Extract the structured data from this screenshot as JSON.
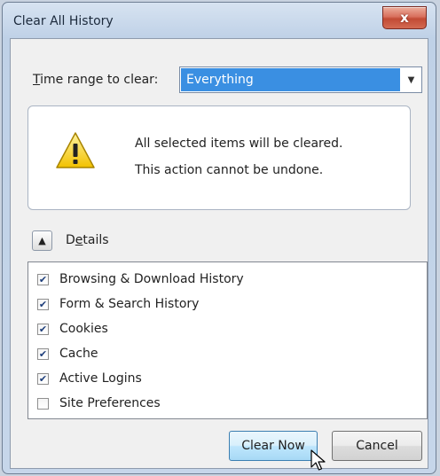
{
  "window": {
    "title": "Clear All History",
    "close_label": "x"
  },
  "time_range": {
    "label": "Time range to clear:",
    "selected": "Everything"
  },
  "warning": {
    "line1": "All selected items will be cleared.",
    "line2": "This action cannot be undone."
  },
  "details": {
    "label": "Details",
    "expanded": true
  },
  "items": [
    {
      "label": "Browsing & Download History",
      "checked": true
    },
    {
      "label": "Form & Search History",
      "checked": true
    },
    {
      "label": "Cookies",
      "checked": true
    },
    {
      "label": "Cache",
      "checked": true
    },
    {
      "label": "Active Logins",
      "checked": true
    },
    {
      "label": "Site Preferences",
      "checked": false
    }
  ],
  "buttons": {
    "clear_now": "Clear Now",
    "cancel": "Cancel"
  },
  "colors": {
    "selection": "#3a8fe2",
    "close_button": "#c24b35",
    "primary_button_border": "#3c7fb1"
  }
}
